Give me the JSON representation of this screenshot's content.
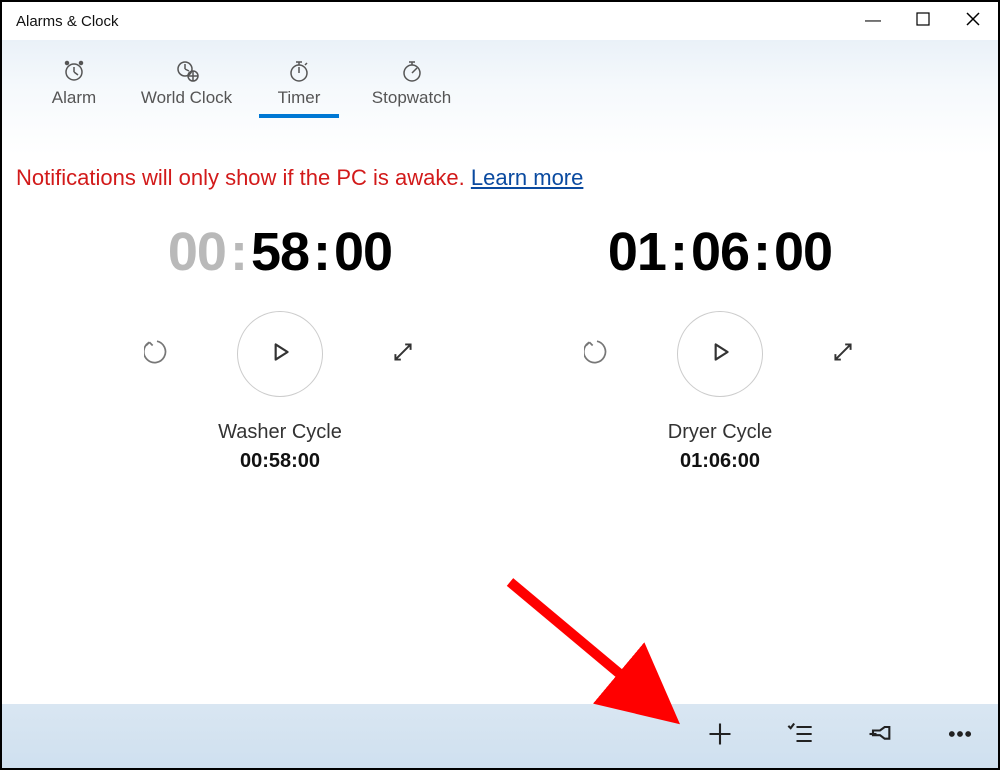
{
  "window": {
    "title": "Alarms & Clock"
  },
  "tabs": [
    {
      "id": "alarm",
      "label": "Alarm",
      "selected": false
    },
    {
      "id": "worldclock",
      "label": "World Clock",
      "selected": false
    },
    {
      "id": "timer",
      "label": "Timer",
      "selected": true
    },
    {
      "id": "stopwatch",
      "label": "Stopwatch",
      "selected": false
    }
  ],
  "notification": {
    "text": "Notifications will only show if the PC is awake. ",
    "link_label": "Learn more"
  },
  "timers": [
    {
      "name": "Washer Cycle",
      "display": {
        "hh": "00",
        "mm": "58",
        "ss": "00",
        "dim_hours": true
      },
      "sub_display": "00:58:00"
    },
    {
      "name": "Dryer Cycle",
      "display": {
        "hh": "01",
        "mm": "06",
        "ss": "00",
        "dim_hours": false
      },
      "sub_display": "01:06:00"
    }
  ],
  "bottom_bar": {
    "buttons": [
      "add-timer",
      "select-timers",
      "pin",
      "more"
    ]
  }
}
